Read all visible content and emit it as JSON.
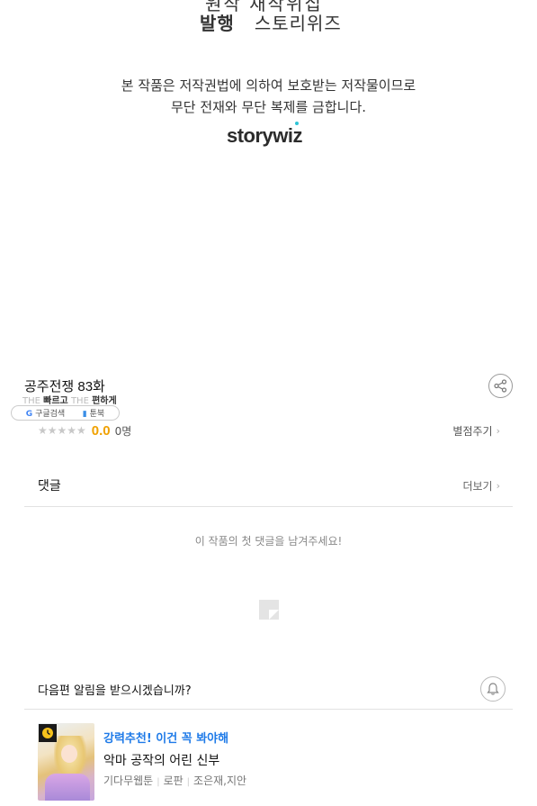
{
  "credits": {
    "row1_text": "원작  재작위집",
    "row2_key": "발행",
    "row2_value": "스토리위즈",
    "copyright_line1": "본 작품은 저작권법에 의하여 보호받는 저작물이므로",
    "copyright_line2": "무단 전재와 무단 복제를 금합니다.",
    "logo_text": "storywiz"
  },
  "episode": {
    "title": "공주전쟁 83화"
  },
  "ad_overlay": {
    "line1_brand": "THE",
    "line1_text": "빠르고",
    "line1_brand2": "THE",
    "line1_text2": "편하게",
    "pill_left": "구글검색",
    "pill_right": "툰북"
  },
  "rating": {
    "stars": "★★★★★",
    "score": "0.0",
    "count": "0명",
    "rate_label": "별점주기"
  },
  "comments": {
    "label": "댓글",
    "more_label": "더보기",
    "empty_message": "이 작품의 첫 댓글을 남겨주세요!"
  },
  "notify": {
    "question": "다음편 알림을 받으시겠습니까?"
  },
  "recommendation": {
    "promo": "강력추천! 이건 꼭 봐야해",
    "title": "악마 공작의 어린 신부",
    "genre": "기다무웹툰",
    "category": "로판",
    "authors": "조은재,지안"
  },
  "colors": {
    "accent_rating": "#f0a100",
    "accent_promo": "#1e7ae8",
    "divider": "#e2e2e2"
  }
}
